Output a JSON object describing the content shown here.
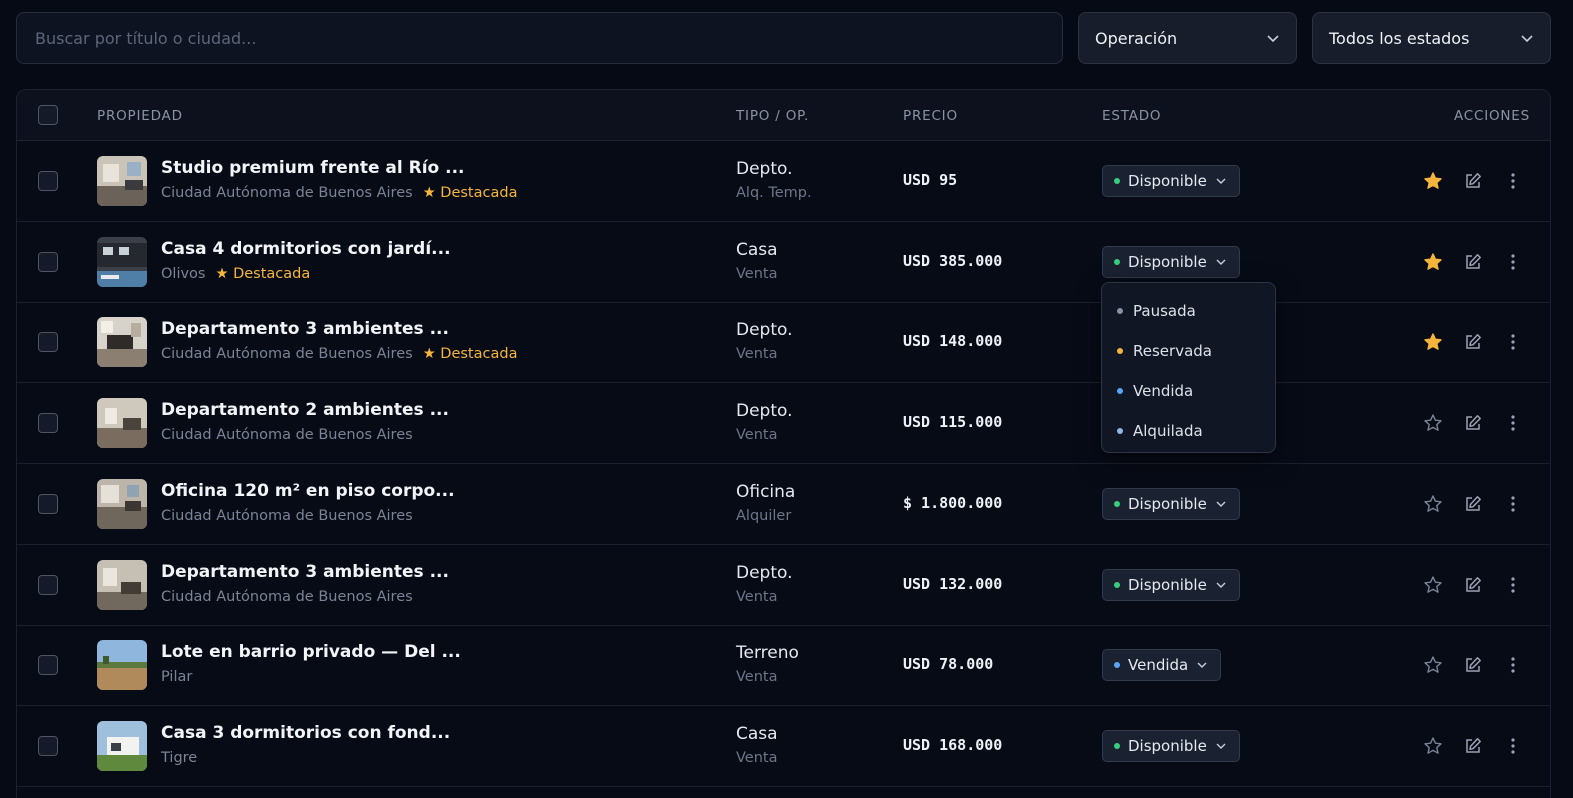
{
  "search": {
    "placeholder": "Buscar por título o ciudad..."
  },
  "filters": {
    "operation": "Operación",
    "status": "Todos los estados"
  },
  "table": {
    "headers": {
      "property": "PROPIEDAD",
      "type": "TIPO / OP.",
      "price": "PRECIO",
      "status": "ESTADO",
      "actions": "ACCIONES"
    },
    "featured_label": "★ Destacada",
    "rows": [
      {
        "title": "Studio premium frente al Río ...",
        "location": "Ciudad Autónoma de Buenos Aires",
        "featured": true,
        "type": "Depto.",
        "operation": "Alq. Temp.",
        "price": "USD 95",
        "status": "Disponible",
        "status_color": "#34d07a",
        "starred": true
      },
      {
        "title": "Casa 4 dormitorios con jardí...",
        "location": "Olivos",
        "featured": true,
        "type": "Casa",
        "operation": "Venta",
        "price": "USD 385.000",
        "status": "Disponible",
        "status_color": "#34d07a",
        "starred": true
      },
      {
        "title": "Departamento 3 ambientes ...",
        "location": "Ciudad Autónoma de Buenos Aires",
        "featured": true,
        "type": "Depto.",
        "operation": "Venta",
        "price": "USD 148.000",
        "status": "",
        "status_color": "#34d07a",
        "starred": true
      },
      {
        "title": "Departamento 2 ambientes ...",
        "location": "Ciudad Autónoma de Buenos Aires",
        "featured": false,
        "type": "Depto.",
        "operation": "Venta",
        "price": "USD 115.000",
        "status": "",
        "status_color": "#34d07a",
        "starred": false
      },
      {
        "title": "Oficina 120 m² en piso corpo...",
        "location": "Ciudad Autónoma de Buenos Aires",
        "featured": false,
        "type": "Oficina",
        "operation": "Alquiler",
        "price": "$ 1.800.000",
        "status": "Disponible",
        "status_color": "#34d07a",
        "starred": false
      },
      {
        "title": "Departamento 3 ambientes ...",
        "location": "Ciudad Autónoma de Buenos Aires",
        "featured": false,
        "type": "Depto.",
        "operation": "Venta",
        "price": "USD 132.000",
        "status": "Disponible",
        "status_color": "#34d07a",
        "starred": false
      },
      {
        "title": "Lote en barrio privado — Del ...",
        "location": "Pilar",
        "featured": false,
        "type": "Terreno",
        "operation": "Venta",
        "price": "USD 78.000",
        "status": "Vendida",
        "status_color": "#5aa6f5",
        "starred": false
      },
      {
        "title": "Casa 3 dormitorios con fond...",
        "location": "Tigre",
        "featured": false,
        "type": "Casa",
        "operation": "Venta",
        "price": "USD 168.000",
        "status": "Disponible",
        "status_color": "#34d07a",
        "starred": false
      }
    ]
  },
  "status_menu": {
    "items": [
      {
        "label": "Pausada",
        "color": "#8a92a4"
      },
      {
        "label": "Reservada",
        "color": "#f5b53c"
      },
      {
        "label": "Vendida",
        "color": "#5aa6f5"
      },
      {
        "label": "Alquilada",
        "color": "#8fb8e8"
      }
    ]
  },
  "colors": {
    "accent_star": "#f5b53c",
    "available": "#34d07a",
    "sold": "#5aa6f5"
  }
}
